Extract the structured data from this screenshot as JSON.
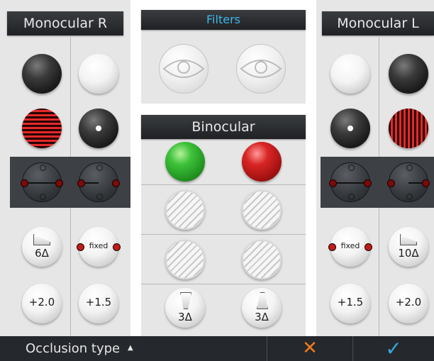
{
  "panels": {
    "monocular_r": "Monocular R",
    "filters": "Filters",
    "binocular": "Binocular",
    "monocular_l": "Monocular L"
  },
  "buttons": {
    "r_prism_a": "6Δ",
    "r_fixed": "fixed",
    "r_plus_a": "+2.0",
    "r_plus_b": "+1.5",
    "bin_prism_a": "3Δ",
    "bin_prism_b": "3Δ",
    "l_fixed": "fixed",
    "l_prism_b": "10Δ",
    "l_plus_a": "+1.5",
    "l_plus_b": "+2.0"
  },
  "footer": {
    "occlusion_label": "Occlusion type",
    "caret": "▲",
    "cancel": "✕",
    "confirm": "✓"
  },
  "colors": {
    "accent_blue": "#3bb7ea",
    "cancel_orange": "#f07a1a",
    "confirm_blue": "#3aa6e0"
  }
}
